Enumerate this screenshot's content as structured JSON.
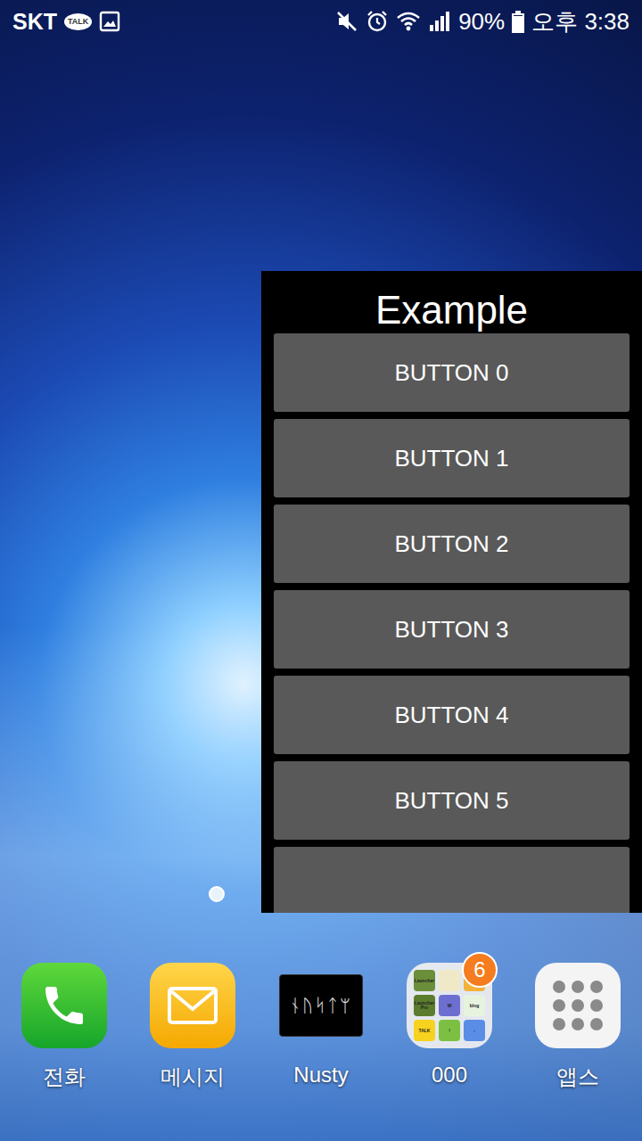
{
  "status_bar": {
    "carrier": "SKT",
    "talk_badge": "TALK",
    "muted": true,
    "alarm": true,
    "battery": "90%",
    "battery_level": 0.9,
    "time": "오후 3:38"
  },
  "window": {
    "title": "Example",
    "buttons": [
      "BUTTON 0",
      "BUTTON 1",
      "BUTTON 2",
      "BUTTON 3",
      "BUTTON 4",
      "BUTTON 5"
    ],
    "more_below": true
  },
  "home_dots": [
    {
      "selected": true
    }
  ],
  "dock": [
    {
      "label": "전화",
      "kind": "phone"
    },
    {
      "label": "메시지",
      "kind": "message"
    },
    {
      "label": "Nusty",
      "kind": "logo",
      "logo_text": "ᚾᚢᛋᛏᛘ"
    },
    {
      "label": "000",
      "kind": "folder",
      "badge": "6",
      "tiles": [
        {
          "label": "Launcher",
          "color": "#6b8e3a"
        },
        {
          "label": "",
          "color": "#f0e9c8"
        },
        {
          "label": "",
          "color": "#f3b23a"
        },
        {
          "label": "Launcher Pro",
          "color": "#5b7d2d"
        },
        {
          "label": "W",
          "color": "#6d6fd0"
        },
        {
          "label": "blog",
          "color": "#e7f3df"
        },
        {
          "label": "TALK",
          "color": "#f7d21e"
        },
        {
          "label": "!",
          "color": "#7bc043"
        },
        {
          "label": "♪",
          "color": "#5a8ee6"
        }
      ]
    },
    {
      "label": "앱스",
      "kind": "apps"
    }
  ]
}
